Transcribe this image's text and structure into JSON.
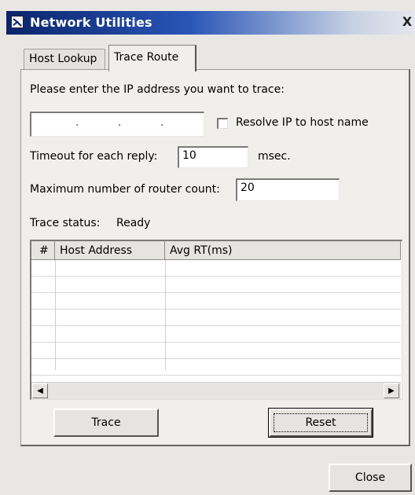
{
  "window": {
    "title": "Network Utilities",
    "close_glyph": "X"
  },
  "tabs": [
    {
      "label": "Host Lookup",
      "active": false
    },
    {
      "label": "Trace Route",
      "active": true
    }
  ],
  "form": {
    "prompt": "Please enter the IP address you want to trace:",
    "ip_value": "",
    "ip_separator": ".",
    "resolve_label": "Resolve IP to host name",
    "resolve_checked": false,
    "timeout_label": "Timeout for each reply:",
    "timeout_value": "10",
    "timeout_unit": "msec.",
    "max_router_label": "Maximum number of router count:",
    "max_router_value": "20",
    "status_label": "Trace status:",
    "status_value": "Ready"
  },
  "table": {
    "columns": [
      "#",
      "Host Address",
      "Avg RT(ms)"
    ],
    "rows": []
  },
  "buttons": {
    "trace": "Trace",
    "reset": "Reset",
    "close": "Close"
  },
  "icons": {
    "scroll_left": "scroll-left-arrow-icon",
    "scroll_right": "scroll-right-arrow-icon",
    "app": "network-utilities-icon"
  }
}
